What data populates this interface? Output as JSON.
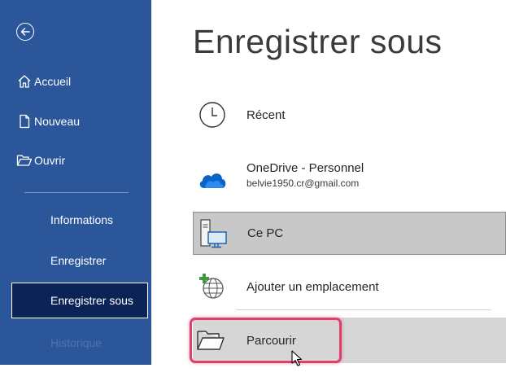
{
  "sidebar": {
    "back_label": "Retour",
    "items": [
      {
        "label": "Accueil",
        "icon": "home-icon"
      },
      {
        "label": "Nouveau",
        "icon": "new-document-icon"
      },
      {
        "label": "Ouvrir",
        "icon": "open-folder-icon"
      }
    ],
    "sub_items": [
      {
        "label": "Informations"
      },
      {
        "label": "Enregistrer"
      },
      {
        "label": "Enregistrer sous",
        "active": true
      },
      {
        "label": "Historique",
        "disabled": true
      }
    ]
  },
  "main": {
    "title": "Enregistrer sous",
    "locations": [
      {
        "name": "Récent",
        "icon": "clock-icon"
      },
      {
        "name": "OneDrive - Personnel",
        "sub": "belvie1950.cr@gmail.com",
        "icon": "onedrive-cloud-icon"
      },
      {
        "name": "Ce PC",
        "icon": "computer-icon",
        "selected": true
      },
      {
        "name": "Ajouter un emplacement",
        "icon": "add-location-globe-icon"
      },
      {
        "name": "Parcourir",
        "icon": "browse-folder-icon",
        "hovered": true
      }
    ]
  },
  "colors": {
    "sidebar_bg": "#2b579a",
    "active_item_bg": "#0b2356",
    "highlight": "#e33d6b",
    "onedrive_blue": "#0a64c8"
  }
}
